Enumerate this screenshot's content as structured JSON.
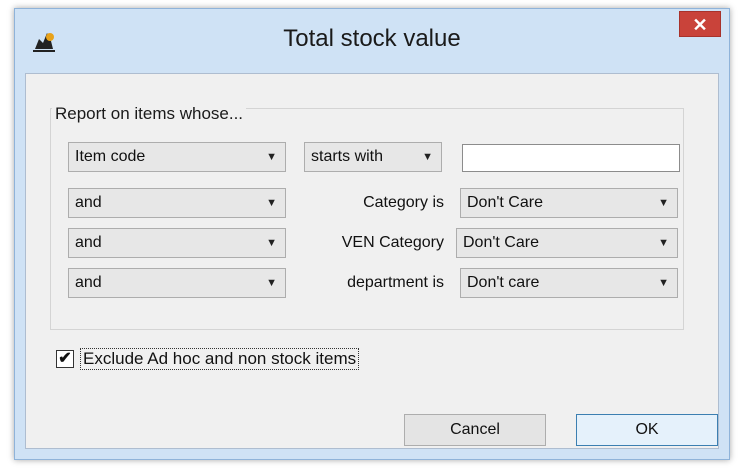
{
  "window": {
    "title": "Total stock value",
    "close_symbol": "✕",
    "app_icon": "mSupply-logo-icon"
  },
  "filter": {
    "group_label": "Report on items whose...",
    "rows": [
      {
        "selector": "Item code",
        "operator": "starts with",
        "value": ""
      },
      {
        "selector": "and",
        "label": "Category is",
        "value": "Don't Care"
      },
      {
        "selector": "and",
        "label": "VEN Category",
        "value": "Don't Care"
      },
      {
        "selector": "and",
        "label": "department is",
        "value": "Don't care"
      }
    ]
  },
  "options": {
    "exclude_label": "Exclude Ad hoc and non stock items",
    "exclude_checked": "✔"
  },
  "buttons": {
    "cancel": "Cancel",
    "ok": "OK"
  },
  "icons": {
    "dropdown": "▼"
  }
}
